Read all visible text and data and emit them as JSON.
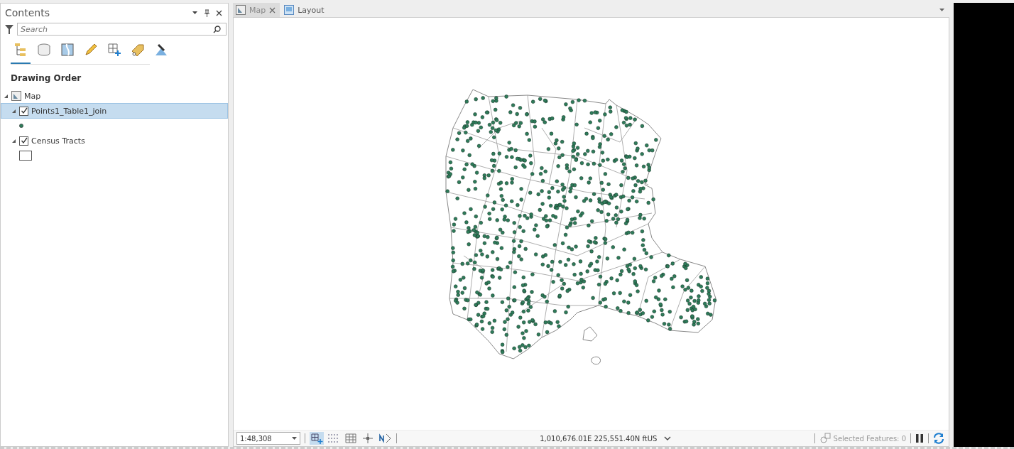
{
  "contents_pane": {
    "title": "Contents",
    "search": {
      "placeholder": "Search"
    },
    "tool_tabs": [
      {
        "kind": "drawing-order",
        "selected": true
      },
      {
        "kind": "source",
        "selected": false
      },
      {
        "kind": "selection",
        "selected": false
      },
      {
        "kind": "editing",
        "selected": false
      },
      {
        "kind": "snapping",
        "selected": false
      },
      {
        "kind": "labeling",
        "selected": false
      },
      {
        "kind": "perspective",
        "selected": false
      }
    ],
    "heading": "Drawing Order",
    "layers": [
      {
        "name": "Map",
        "kind": "map",
        "expanded": true,
        "children": [
          {
            "name": "Points1_Table1_join",
            "kind": "points",
            "checked": true,
            "selected": true,
            "expanded": true
          },
          {
            "name": "Census Tracts",
            "kind": "polygons",
            "checked": true,
            "selected": false,
            "expanded": true
          }
        ]
      }
    ]
  },
  "view_tabs": [
    {
      "label": "Map",
      "kind": "map",
      "selected": true,
      "closable": true
    },
    {
      "label": "Layout",
      "kind": "layout",
      "selected": false,
      "closable": false
    }
  ],
  "status_bar": {
    "scale": "1:48,308",
    "coordinates": "1,010,676.01E 225,551.40N ftUS",
    "selected_features": "Selected Features: 0"
  }
}
